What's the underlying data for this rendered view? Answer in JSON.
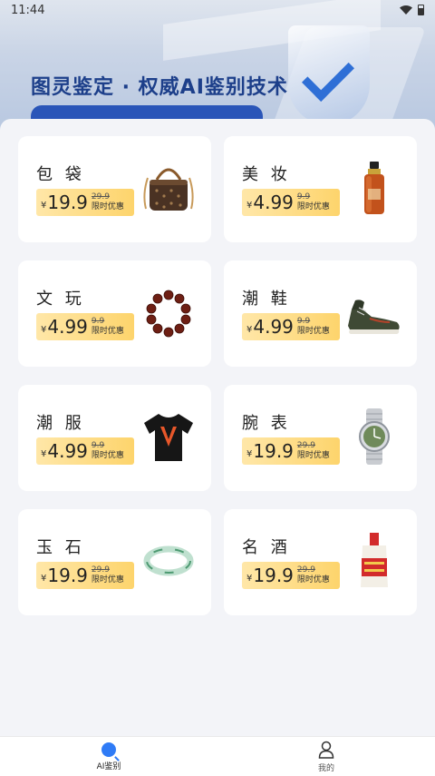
{
  "status_bar": {
    "time": "11:44"
  },
  "banner": {
    "title": "图灵鉴定 · 权威AI鉴别技术"
  },
  "currency_symbol": "¥",
  "promo_label": "限时优惠",
  "categories": [
    {
      "name": "包 袋",
      "price": "19.9",
      "old_price": "29.9",
      "icon": "handbag-icon"
    },
    {
      "name": "美 妆",
      "price": "4.99",
      "old_price": "9.9",
      "icon": "serum-bottle-icon"
    },
    {
      "name": "文 玩",
      "price": "4.99",
      "old_price": "9.9",
      "icon": "bead-bracelet-icon"
    },
    {
      "name": "潮 鞋",
      "price": "4.99",
      "old_price": "9.9",
      "icon": "sneaker-icon"
    },
    {
      "name": "潮 服",
      "price": "4.99",
      "old_price": "9.9",
      "icon": "tshirt-icon"
    },
    {
      "name": "腕 表",
      "price": "19.9",
      "old_price": "29.9",
      "icon": "wristwatch-icon"
    },
    {
      "name": "玉 石",
      "price": "19.9",
      "old_price": "29.9",
      "icon": "jade-bangle-icon"
    },
    {
      "name": "名 酒",
      "price": "19.9",
      "old_price": "29.9",
      "icon": "liquor-bottle-icon"
    }
  ],
  "tabs": [
    {
      "label": "AI鉴别",
      "icon": "ai-search-icon",
      "active": true
    },
    {
      "label": "我的",
      "icon": "user-icon",
      "active": false
    }
  ],
  "colors": {
    "accent": "#2f7bf6",
    "price_tag_start": "#ffe7a8",
    "price_tag_end": "#fdd46c",
    "banner_title": "#1d3f8a"
  }
}
